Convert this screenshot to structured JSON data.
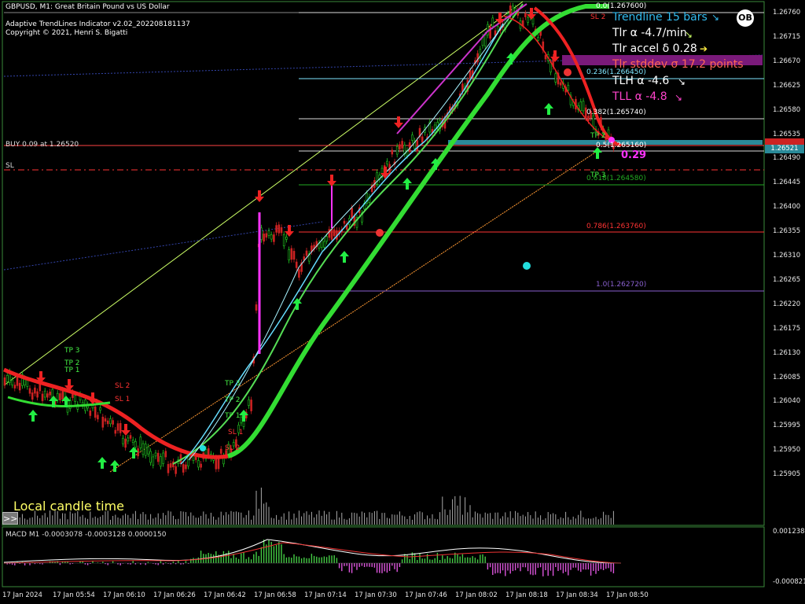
{
  "header": {
    "symbol_line": "GBPUSD, M1: Great Britain Pound vs US Dollar",
    "indicator_line": "Adaptive TrendLines Indicator v2.02_202208181137",
    "copyright_line": "Copyright © 2021, Henri S. Bigatti"
  },
  "order_lines": {
    "buy_label": "BUY 0.09 at 1.26520",
    "sl_label": "SL"
  },
  "fib_levels": [
    {
      "label": "0.0(1.267600)",
      "color": "#ffffff"
    },
    {
      "label": "0.236(1.266450)",
      "color": "#7fe6ff"
    },
    {
      "label": "0.382(1.265740)",
      "color": "#ffffff"
    },
    {
      "label": "0.5(1.265160)",
      "color": "#ffffff"
    },
    {
      "label": "0.618(1.264580)",
      "color": "#22aa22"
    },
    {
      "label": "0.786(1.263760)",
      "color": "#ff3333"
    },
    {
      "label": "1.0(1.262720)",
      "color": "#8a60d0"
    }
  ],
  "target_labels": {
    "left": [
      "TP 3",
      "TP 2",
      "TP 1"
    ],
    "left_sl": [
      "SL 2",
      "SL 1"
    ],
    "mid": [
      "TP 3",
      "TP 2",
      "TP 1"
    ],
    "mid_sl": [
      "SL 1",
      "SL 2"
    ],
    "right_sl": "SL 2",
    "right_tp": [
      "TP 2",
      "TP 3"
    ]
  },
  "info_panel": {
    "trendline": "Trendline 15 bars",
    "tlr_alpha": "Tlr α -4.7/min",
    "tlr_accel": "Tlr accel δ 0.28",
    "tlr_stddev": "Tlr stddev σ 17.2 points",
    "tlh_alpha": "TLH α -4.6",
    "tll_alpha": "TLL α -4.8",
    "ratio": "0.29"
  },
  "local_time_label": "Local candle time",
  "toggle_button": ">>",
  "logo_text": "OB",
  "price_axis": [
    "1.26760",
    "1.26715",
    "1.26670",
    "1.26625",
    "1.26580",
    "1.26535",
    "1.26490",
    "1.26445",
    "1.26400",
    "1.26355",
    "1.26310",
    "1.26265",
    "1.26220",
    "1.26175",
    "1.26130",
    "1.26085",
    "1.26040",
    "1.25995",
    "1.25950",
    "1.25905"
  ],
  "current_price": "1.26521",
  "macd": {
    "label": "MACD M1 -0.0003078 -0.0003128 0.0000150",
    "axis_top": "0.0012384",
    "axis_bottom": "-0.0008211"
  },
  "time_axis": [
    "17 Jan 2024",
    "17 Jan 05:54",
    "17 Jan 06:10",
    "17 Jan 06:26",
    "17 Jan 06:42",
    "17 Jan 06:58",
    "17 Jan 07:14",
    "17 Jan 07:30",
    "17 Jan 07:46",
    "17 Jan 08:02",
    "17 Jan 08:18",
    "17 Jan 08:34",
    "17 Jan 08:50"
  ],
  "colors": {
    "background": "#000000",
    "grid_frame": "#3a8a3a",
    "up_arrow": "#22ee44",
    "down_arrow": "#ee2222",
    "ma_thick": "#33dd33",
    "ma_red": "#ee2222",
    "fast_line": "#66ddff",
    "magenta": "#ff33ff"
  }
}
